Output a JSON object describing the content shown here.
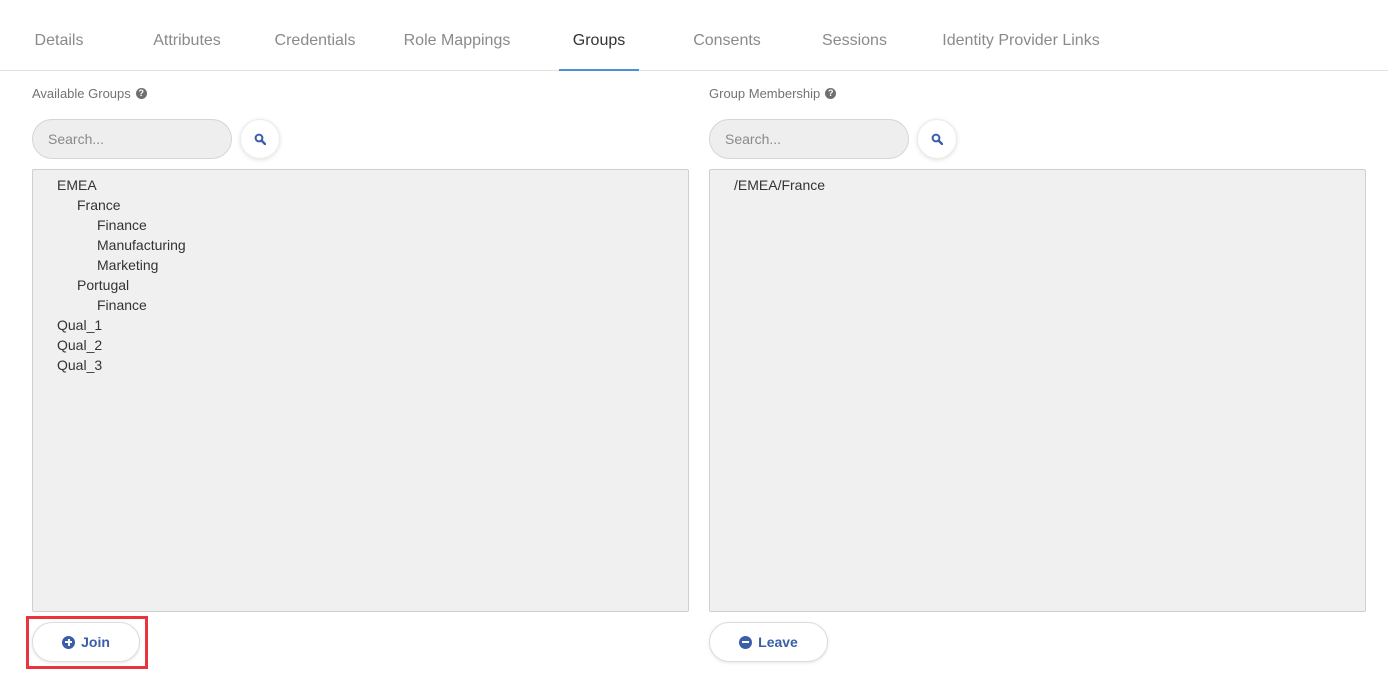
{
  "tabs": [
    {
      "label": "Details",
      "active": false
    },
    {
      "label": "Attributes",
      "active": false
    },
    {
      "label": "Credentials",
      "active": false
    },
    {
      "label": "Role Mappings",
      "active": false
    },
    {
      "label": "Groups",
      "active": true
    },
    {
      "label": "Consents",
      "active": false
    },
    {
      "label": "Sessions",
      "active": false
    },
    {
      "label": "Identity Provider Links",
      "active": false
    }
  ],
  "available": {
    "label": "Available Groups",
    "search_placeholder": "Search...",
    "items": [
      {
        "label": "EMEA",
        "level": 0
      },
      {
        "label": "France",
        "level": 1
      },
      {
        "label": "Finance",
        "level": 2
      },
      {
        "label": "Manufacturing",
        "level": 2
      },
      {
        "label": "Marketing",
        "level": 2
      },
      {
        "label": "Portugal",
        "level": 1
      },
      {
        "label": "Finance",
        "level": 2
      },
      {
        "label": "Qual_1",
        "level": 0
      },
      {
        "label": "Qual_2",
        "level": 0
      },
      {
        "label": "Qual_3",
        "level": 0
      }
    ],
    "action_label": "Join"
  },
  "membership": {
    "label": "Group Membership",
    "search_placeholder": "Search...",
    "items": [
      {
        "label": "/EMEA/France",
        "level": 0
      }
    ],
    "action_label": "Leave"
  },
  "colors": {
    "accent": "#3a5ea8",
    "tab_underline": "#4a90d9",
    "highlight": "#e8343f"
  }
}
